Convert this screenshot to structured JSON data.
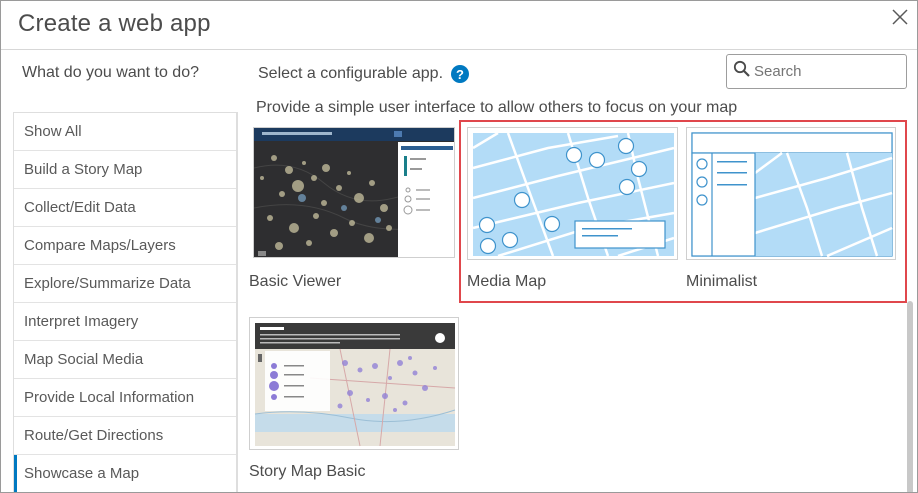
{
  "dialog": {
    "title": "Create a web app",
    "close_icon": "close-icon"
  },
  "sidebar": {
    "heading": "What do you want to do?",
    "items": [
      {
        "label": "Show All"
      },
      {
        "label": "Build a Story Map"
      },
      {
        "label": "Collect/Edit Data"
      },
      {
        "label": "Compare Maps/Layers"
      },
      {
        "label": "Explore/Summarize Data"
      },
      {
        "label": "Interpret Imagery"
      },
      {
        "label": "Map Social Media"
      },
      {
        "label": "Provide Local Information"
      },
      {
        "label": "Route/Get Directions"
      },
      {
        "label": "Showcase a Map"
      }
    ],
    "active_item": "Showcase a Map",
    "active_color": "#0079c1"
  },
  "main": {
    "select_label": "Select a configurable app.",
    "help_icon": "help-icon",
    "help_glyph": "?",
    "search": {
      "placeholder": "Search",
      "value": "",
      "icon": "search-icon"
    },
    "description": "Provide a simple user interface to allow others to focus on your map",
    "apps": [
      {
        "name": "Basic Viewer"
      },
      {
        "name": "Media Map"
      },
      {
        "name": "Minimalist"
      },
      {
        "name": "Story Map Basic"
      }
    ],
    "highlight_color": "#e0474c",
    "map_blue": "#b3dcf7"
  }
}
